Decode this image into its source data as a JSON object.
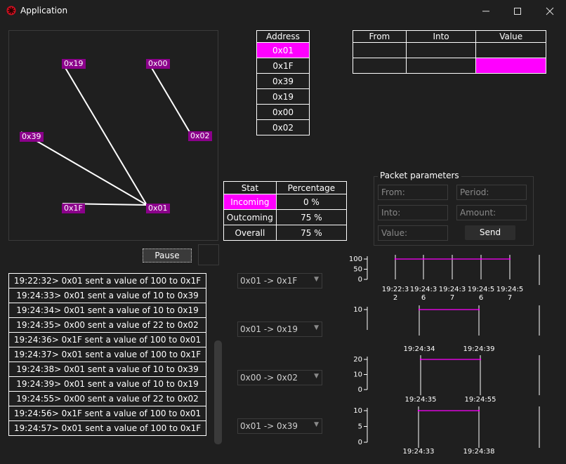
{
  "window": {
    "title": "Application",
    "minimize_icon": "minimize-icon",
    "maximize_icon": "maximize-icon",
    "close_icon": "close-icon"
  },
  "graph": {
    "nodes": [
      "0x19",
      "0x00",
      "0x39",
      "0x02",
      "0x1F",
      "0x01"
    ],
    "edges": [
      [
        "0x19",
        "0x01"
      ],
      [
        "0x39",
        "0x01"
      ],
      [
        "0x1F",
        "0x01"
      ],
      [
        "0x00",
        "0x02"
      ]
    ],
    "label_color": "#8b008b"
  },
  "address_table": {
    "header": "Address",
    "rows": [
      "0x01",
      "0x1F",
      "0x39",
      "0x19",
      "0x00",
      "0x02"
    ],
    "selected": "0x01"
  },
  "transfer_table": {
    "headers": [
      "From",
      "Into",
      "Value"
    ],
    "rows": [
      [
        "",
        "",
        ""
      ],
      [
        "",
        "",
        ""
      ]
    ]
  },
  "stat_table": {
    "headers": [
      "Stat",
      "Percentage"
    ],
    "rows": [
      [
        "Incoming",
        "0 %"
      ],
      [
        "Outcoming",
        "75 %"
      ],
      [
        "Overall",
        "75 %"
      ]
    ],
    "selected": "Incoming"
  },
  "packet": {
    "legend": "Packet parameters",
    "from_placeholder": "From:",
    "period_placeholder": "Period:",
    "into_placeholder": "Into:",
    "amount_placeholder": "Amount:",
    "value_placeholder": "Value:",
    "send_label": "Send"
  },
  "pause_label": "Pause",
  "log": [
    "19:22:32> 0x01 sent a value of 100 to 0x1F",
    "19:24:33> 0x01 sent a value of 10 to 0x39",
    "19:24:34> 0x01 sent a value of 10 to 0x19",
    "19:24:35> 0x00 sent a value of 22 to 0x02",
    "19:24:36> 0x1F sent a value of 100 to 0x01",
    "19:24:37> 0x01 sent a value of 100 to 0x1F",
    "19:24:38> 0x01 sent a value of 10 to 0x39",
    "19:24:39> 0x01 sent a value of 10 to 0x19",
    "19:24:55> 0x00 sent a value of 22 to 0x02",
    "19:24:56> 0x1F sent a value of 100 to 0x01",
    "19:24:57> 0x01 sent a value of 100 to 0x1F"
  ],
  "combos": [
    "0x01 -> 0x1F",
    "0x01 -> 0x19",
    "0x00 -> 0x02",
    "0x01 -> 0x39"
  ],
  "accent": "#ff00ff",
  "chart_data": [
    {
      "type": "line",
      "yticks": [
        "100",
        "50",
        "0"
      ],
      "ylim": [
        0,
        100
      ],
      "xticks": [
        [
          "19:22:3",
          "2"
        ],
        [
          "19:24:3",
          "6"
        ],
        [
          "19:24:3",
          "7"
        ],
        [
          "19:24:5",
          "6"
        ],
        [
          "19:24:5",
          "7"
        ]
      ],
      "series": [
        {
          "values": [
            100,
            100,
            100,
            100
          ]
        }
      ]
    },
    {
      "type": "line",
      "yticks": [
        "10"
      ],
      "ylim": [
        0,
        10
      ],
      "xticks": [
        [
          "19:24:34"
        ],
        [
          "19:24:39"
        ]
      ],
      "series": [
        {
          "values": [
            10,
            10
          ]
        }
      ]
    },
    {
      "type": "line",
      "yticks": [
        "20",
        "10",
        "0"
      ],
      "ylim": [
        0,
        22
      ],
      "xticks": [
        [
          "19:24:35"
        ],
        [
          "19:24:55"
        ]
      ],
      "series": [
        {
          "values": [
            22,
            22
          ]
        }
      ]
    },
    {
      "type": "line",
      "yticks": [
        "10",
        "5",
        "0"
      ],
      "ylim": [
        0,
        10
      ],
      "xticks": [
        [
          "19:24:33"
        ],
        [
          "19:24:38"
        ]
      ],
      "series": [
        {
          "values": [
            10,
            10
          ]
        }
      ]
    }
  ]
}
